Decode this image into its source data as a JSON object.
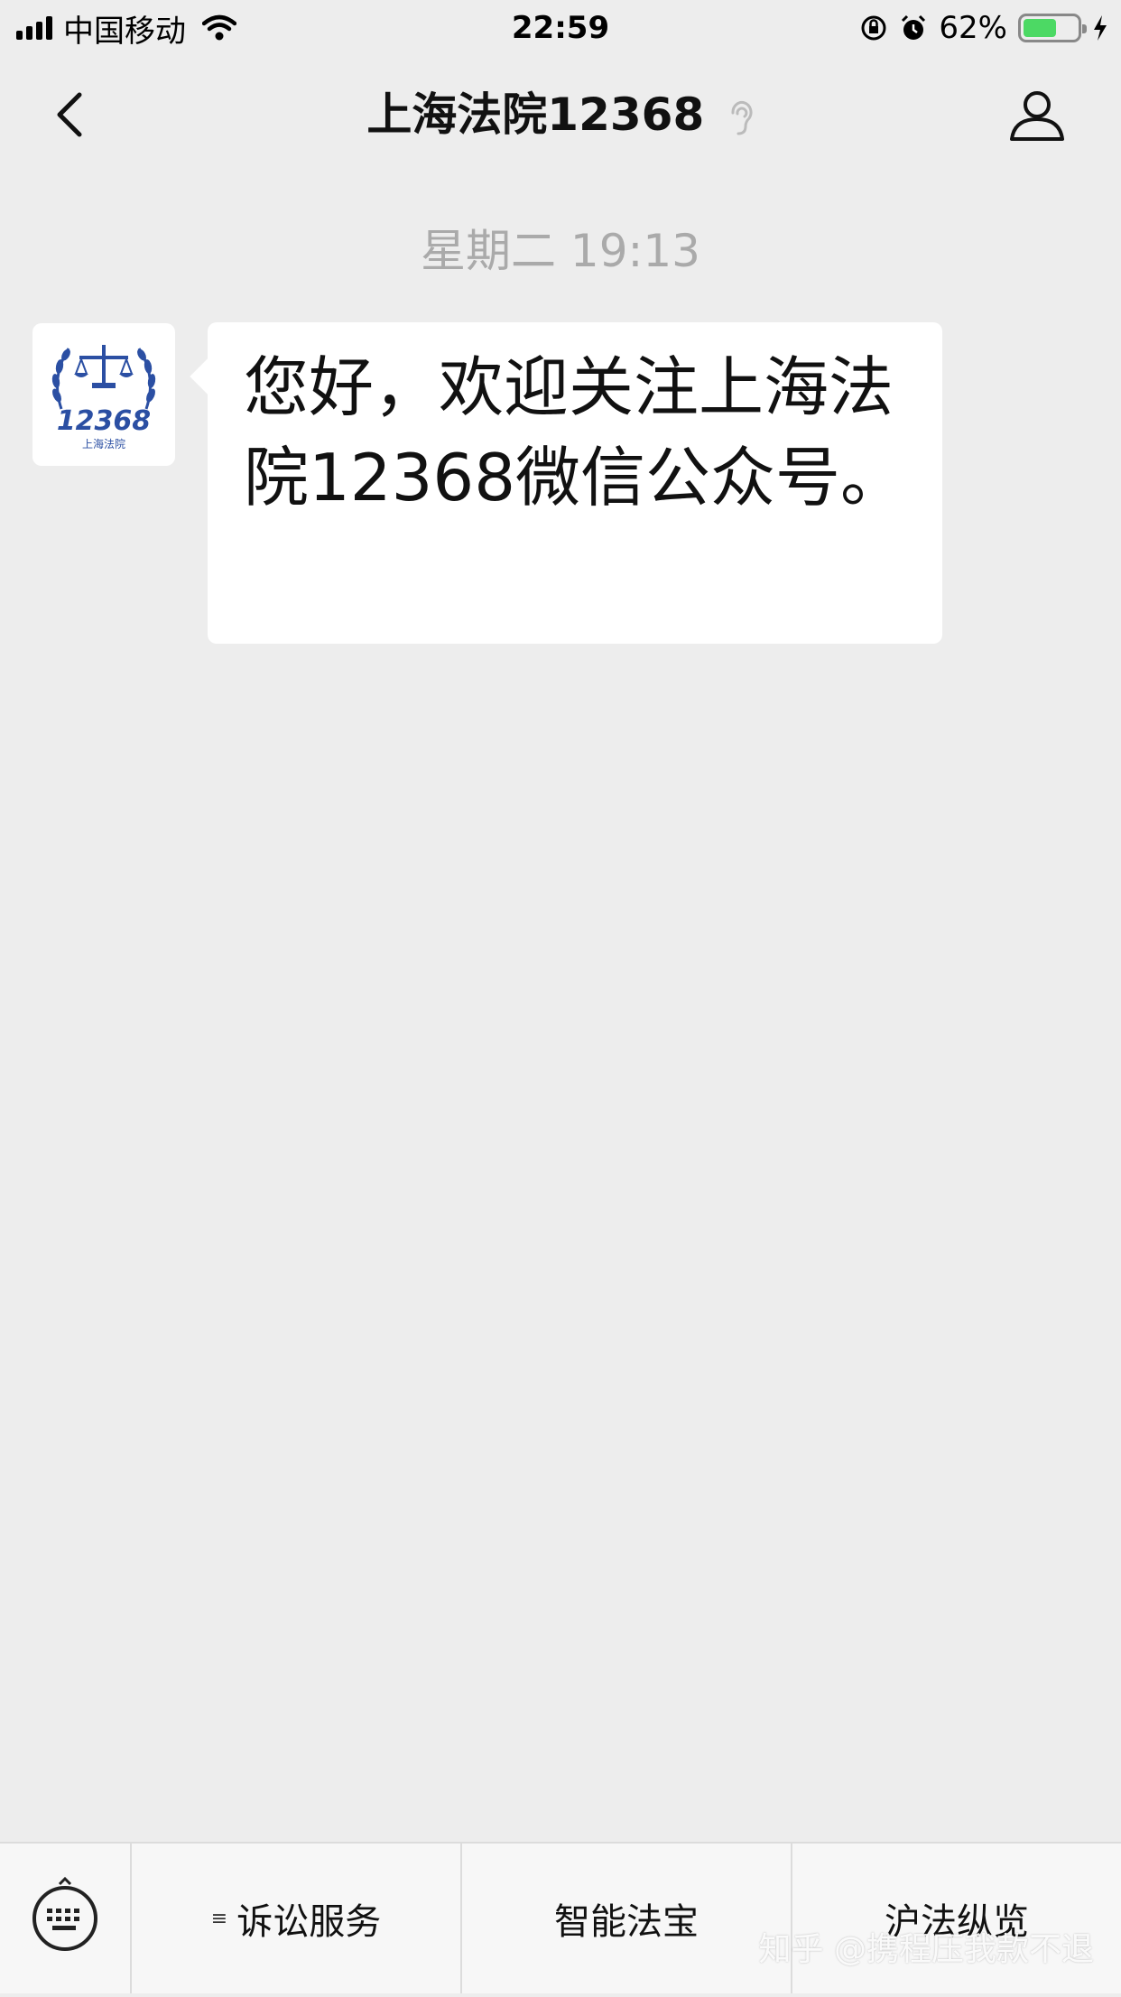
{
  "status_bar": {
    "carrier": "中国移动",
    "time": "22:59",
    "battery": "62%",
    "battery_level": 0.62,
    "icons": [
      "signal-icon",
      "wifi-icon",
      "rotation-lock-icon",
      "alarm-icon",
      "battery-icon",
      "charging-icon"
    ]
  },
  "nav": {
    "title": "上海法院12368",
    "back_icon": "chevron-left-icon",
    "ear_icon": "ear-icon",
    "profile_icon": "person-icon"
  },
  "chat": {
    "timestamp": "星期二 19:13",
    "messages": [
      {
        "sender_logo_text": "12368",
        "sender_logo_subtext": "上海法院",
        "text": "您好，欢迎关注上海法院12368微信公众号。"
      }
    ]
  },
  "menu": {
    "keyboard_icon": "keyboard-icon",
    "items": [
      {
        "label": "诉讼服务",
        "has_submenu": true
      },
      {
        "label": "智能法宝",
        "has_submenu": false
      },
      {
        "label": "沪法纵览",
        "has_submenu": false
      }
    ]
  },
  "watermark": "知乎 @携程压我款不退",
  "colors": {
    "background": "#ededed",
    "battery_fill": "#4cd964",
    "logo_blue": "#2b4fa3"
  }
}
